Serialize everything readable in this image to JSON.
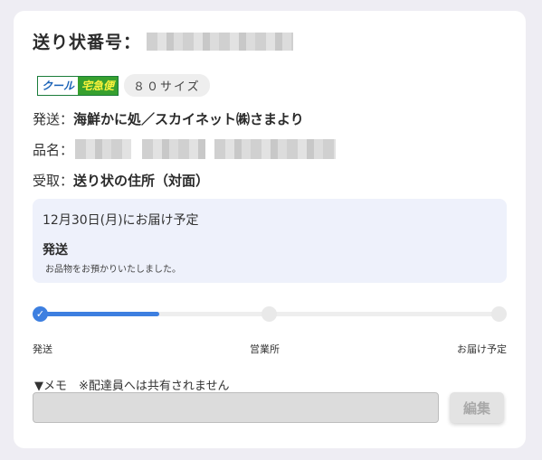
{
  "tracking": {
    "title_label": "送り状番号：",
    "number_redacted": ""
  },
  "service": {
    "logo_cool": "クール",
    "logo_takkyubin": "宅急便",
    "size_label": "８０サイズ"
  },
  "sender": {
    "label": "発送：",
    "value": "海鮮かに処／スカイネット㈱さまより"
  },
  "item": {
    "label": "品名："
  },
  "receiver": {
    "label": "受取：",
    "value": "送り状の住所（対面）"
  },
  "status": {
    "delivery_date": "12月30日(月)にお届け予定",
    "title": "発送",
    "description": "お品物をお預かりいたしました。"
  },
  "progress": {
    "fraction": 0.26,
    "steps": [
      {
        "label": "発送",
        "state": "done"
      },
      {
        "label": "営業所",
        "state": "pending"
      },
      {
        "label": "お届け予定",
        "state": "pending"
      }
    ],
    "check_glyph": "✓",
    "accent_color": "#3d7fe0"
  },
  "memo": {
    "label": "▼メモ　※配達員へは共有されません",
    "input_value": "",
    "edit_label": "編集"
  }
}
